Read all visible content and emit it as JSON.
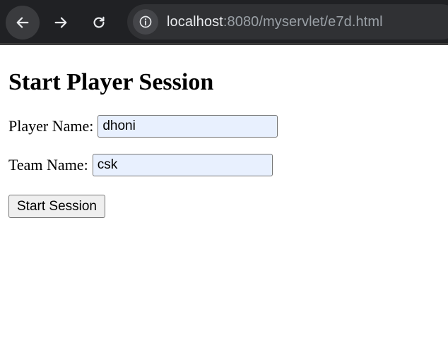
{
  "browser": {
    "url_host": "localhost",
    "url_rest": ":8080/myservlet/e7d.html",
    "icons": [
      "back-arrow-icon",
      "forward-arrow-icon",
      "reload-icon",
      "info-icon"
    ]
  },
  "page": {
    "title": "Start Player Session",
    "form": {
      "player_label": "Player Name:",
      "player_value": "dhoni",
      "team_label": "Team Name:",
      "team_value": "csk",
      "submit_label": "Start Session"
    }
  },
  "colors": {
    "toolbar_bg": "#202124",
    "omnibox_bg": "#303134",
    "autofill_bg": "#e8f0fe",
    "button_bg": "#efefef"
  }
}
